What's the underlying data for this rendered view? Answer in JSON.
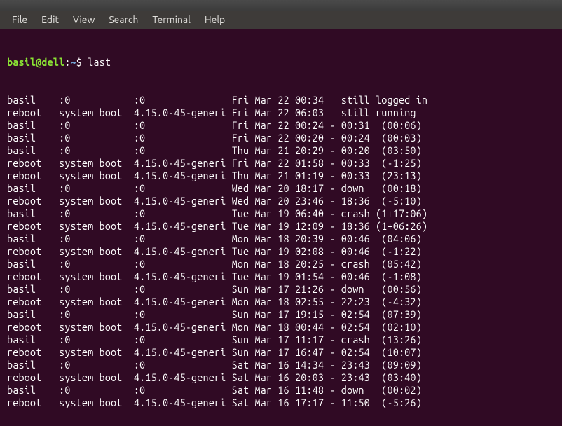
{
  "menubar": {
    "file": "File",
    "edit": "Edit",
    "view": "View",
    "search": "Search",
    "terminal": "Terminal",
    "help": "Help"
  },
  "prompt": {
    "user": "basil",
    "at": "@",
    "host": "dell",
    "colon": ":",
    "path": "~",
    "symbol": "$ "
  },
  "command": "last",
  "rows": [
    {
      "user": "basil",
      "line": ":0",
      "from": ":0",
      "login": "Fri Mar 22 00:34",
      "sep": "",
      "until": "still",
      "dur": "logged in"
    },
    {
      "user": "reboot",
      "line": "system boot",
      "from": "4.15.0-45-generi",
      "login": "Fri Mar 22 06:03",
      "sep": "",
      "until": "still",
      "dur": "running"
    },
    {
      "user": "basil",
      "line": ":0",
      "from": ":0",
      "login": "Fri Mar 22 00:24",
      "sep": "-",
      "until": "00:31",
      "dur": "(00:06)"
    },
    {
      "user": "basil",
      "line": ":0",
      "from": ":0",
      "login": "Fri Mar 22 00:20",
      "sep": "-",
      "until": "00:24",
      "dur": "(00:03)"
    },
    {
      "user": "basil",
      "line": ":0",
      "from": ":0",
      "login": "Thu Mar 21 20:29",
      "sep": "-",
      "until": "00:20",
      "dur": "(03:50)"
    },
    {
      "user": "reboot",
      "line": "system boot",
      "from": "4.15.0-45-generi",
      "login": "Fri Mar 22 01:58",
      "sep": "-",
      "until": "00:33",
      "dur": "(-1:25)"
    },
    {
      "user": "reboot",
      "line": "system boot",
      "from": "4.15.0-45-generi",
      "login": "Thu Mar 21 01:19",
      "sep": "-",
      "until": "00:33",
      "dur": "(23:13)"
    },
    {
      "user": "basil",
      "line": ":0",
      "from": ":0",
      "login": "Wed Mar 20 18:17",
      "sep": "-",
      "until": "down",
      "dur": "(00:18)"
    },
    {
      "user": "reboot",
      "line": "system boot",
      "from": "4.15.0-45-generi",
      "login": "Wed Mar 20 23:46",
      "sep": "-",
      "until": "18:36",
      "dur": "(-5:10)"
    },
    {
      "user": "basil",
      "line": ":0",
      "from": ":0",
      "login": "Tue Mar 19 06:40",
      "sep": "-",
      "until": "crash",
      "dur": "(1+17:06)"
    },
    {
      "user": "reboot",
      "line": "system boot",
      "from": "4.15.0-45-generi",
      "login": "Tue Mar 19 12:09",
      "sep": "-",
      "until": "18:36",
      "dur": "(1+06:26)"
    },
    {
      "user": "basil",
      "line": ":0",
      "from": ":0",
      "login": "Mon Mar 18 20:39",
      "sep": "-",
      "until": "00:46",
      "dur": "(04:06)"
    },
    {
      "user": "reboot",
      "line": "system boot",
      "from": "4.15.0-45-generi",
      "login": "Tue Mar 19 02:08",
      "sep": "-",
      "until": "00:46",
      "dur": "(-1:22)"
    },
    {
      "user": "basil",
      "line": ":0",
      "from": ":0",
      "login": "Mon Mar 18 20:25",
      "sep": "-",
      "until": "crash",
      "dur": "(05:42)"
    },
    {
      "user": "reboot",
      "line": "system boot",
      "from": "4.15.0-45-generi",
      "login": "Tue Mar 19 01:54",
      "sep": "-",
      "until": "00:46",
      "dur": "(-1:08)"
    },
    {
      "user": "basil",
      "line": ":0",
      "from": ":0",
      "login": "Sun Mar 17 21:26",
      "sep": "-",
      "until": "down",
      "dur": "(00:56)"
    },
    {
      "user": "reboot",
      "line": "system boot",
      "from": "4.15.0-45-generi",
      "login": "Mon Mar 18 02:55",
      "sep": "-",
      "until": "22:23",
      "dur": "(-4:32)"
    },
    {
      "user": "basil",
      "line": ":0",
      "from": ":0",
      "login": "Sun Mar 17 19:15",
      "sep": "-",
      "until": "02:54",
      "dur": "(07:39)"
    },
    {
      "user": "reboot",
      "line": "system boot",
      "from": "4.15.0-45-generi",
      "login": "Mon Mar 18 00:44",
      "sep": "-",
      "until": "02:54",
      "dur": "(02:10)"
    },
    {
      "user": "basil",
      "line": ":0",
      "from": ":0",
      "login": "Sun Mar 17 11:17",
      "sep": "-",
      "until": "crash",
      "dur": "(13:26)"
    },
    {
      "user": "reboot",
      "line": "system boot",
      "from": "4.15.0-45-generi",
      "login": "Sun Mar 17 16:47",
      "sep": "-",
      "until": "02:54",
      "dur": "(10:07)"
    },
    {
      "user": "basil",
      "line": ":0",
      "from": ":0",
      "login": "Sat Mar 16 14:34",
      "sep": "-",
      "until": "23:43",
      "dur": "(09:09)"
    },
    {
      "user": "reboot",
      "line": "system boot",
      "from": "4.15.0-45-generi",
      "login": "Sat Mar 16 20:03",
      "sep": "-",
      "until": "23:43",
      "dur": "(03:40)"
    },
    {
      "user": "basil",
      "line": ":0",
      "from": ":0",
      "login": "Sat Mar 16 11:48",
      "sep": "-",
      "until": "down",
      "dur": "(00:02)"
    },
    {
      "user": "reboot",
      "line": "system boot",
      "from": "4.15.0-45-generi",
      "login": "Sat Mar 16 17:17",
      "sep": "-",
      "until": "11:50",
      "dur": "(-5:26)"
    }
  ]
}
